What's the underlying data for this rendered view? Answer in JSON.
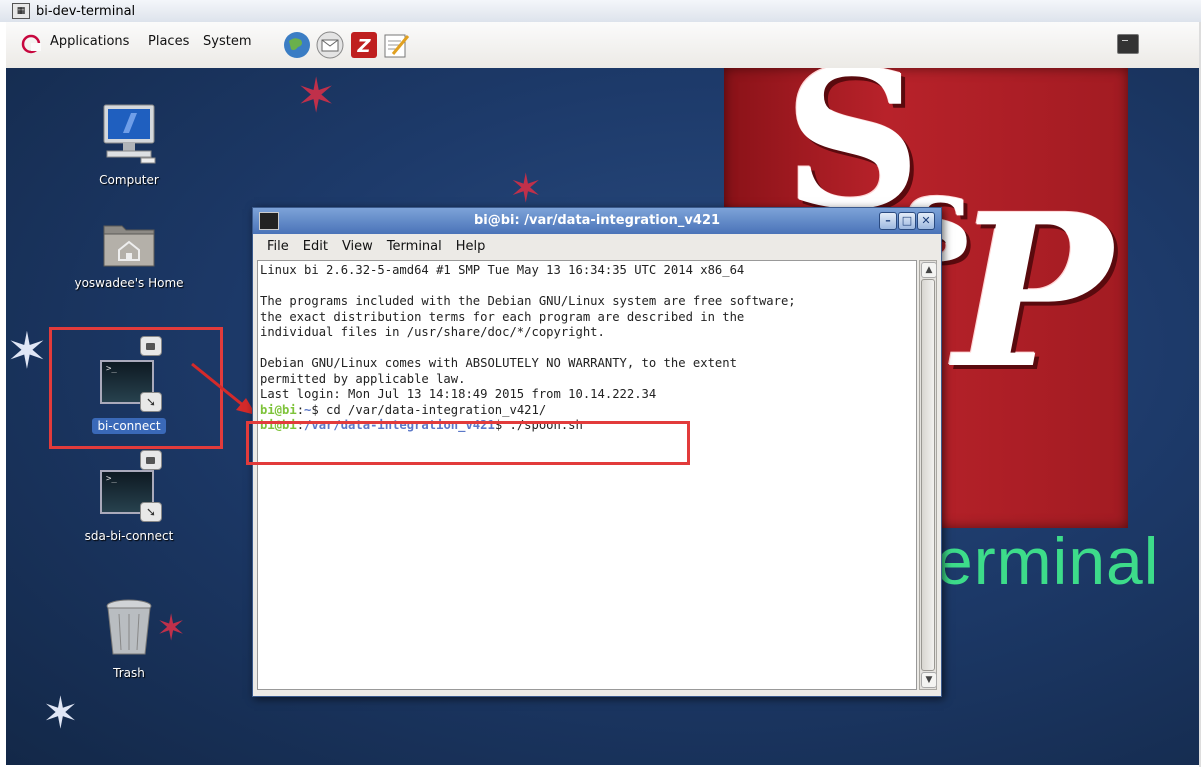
{
  "outer_window": {
    "title": "bi-dev-terminal"
  },
  "panel": {
    "menus": [
      "Applications",
      "Places",
      "System"
    ],
    "launchers": [
      "browser-icon",
      "email-icon",
      "filezilla-icon",
      "text-editor-icon"
    ]
  },
  "desktop_icons": {
    "computer": "Computer",
    "home": "yoswadee's Home",
    "bi_connect": "bi-connect",
    "sda_bi_connect": "sda-bi-connect",
    "trash": "Trash"
  },
  "wallpaper": {
    "logo_text": "SSP",
    "terminal_word": "erminal"
  },
  "terminal": {
    "title": "bi@bi: /var/data-integration_v421",
    "menu": [
      "File",
      "Edit",
      "View",
      "Terminal",
      "Help"
    ],
    "lines": [
      "Linux bi 2.6.32-5-amd64 #1 SMP Tue May 13 16:34:35 UTC 2014 x86_64",
      "",
      "The programs included with the Debian GNU/Linux system are free software;",
      "the exact distribution terms for each program are described in the",
      "individual files in /usr/share/doc/*/copyright.",
      "",
      "Debian GNU/Linux comes with ABSOLUTELY NO WARRANTY, to the extent",
      "permitted by applicable law.",
      "Last login: Mon Jul 13 14:18:49 2015 from 10.14.222.34"
    ],
    "cmd1": {
      "user": "bi@bi",
      "path": "~",
      "cmd": "$ cd /var/data-integration_v421/"
    },
    "cmd2": {
      "user": "bi@bi",
      "path": "/var/data-integration_v421",
      "cmd": "$ ./spoon.sh"
    }
  },
  "colors": {
    "highlight": "#e23b3b",
    "prompt_user": "#7ec33a",
    "prompt_path": "#5b78c8"
  }
}
